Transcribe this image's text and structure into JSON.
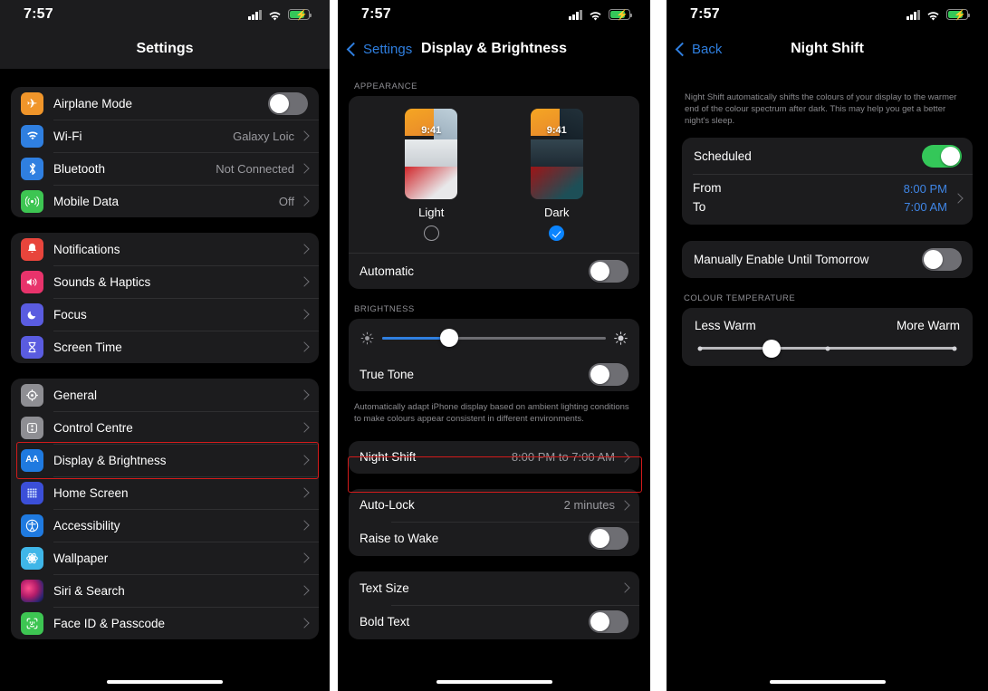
{
  "status_bar": {
    "time": "7:57",
    "signal": "cellular-signal-icon",
    "wifi": "wifi-icon",
    "battery": "battery-charging-icon"
  },
  "panel1": {
    "nav_title": "Settings",
    "groups": [
      {
        "rows": [
          {
            "icon": "airplane-icon",
            "color": "#f0952a",
            "label": "Airplane Mode",
            "control": "toggle",
            "on": false
          },
          {
            "icon": "wifi-icon",
            "color": "#2f7fe0",
            "label": "Wi-Fi",
            "value": "Galaxy Loic",
            "control": "chevron"
          },
          {
            "icon": "bluetooth-icon",
            "color": "#2f7fe0",
            "label": "Bluetooth",
            "value": "Not Connected",
            "control": "chevron"
          },
          {
            "icon": "mobile-data-icon",
            "color": "#3dc552",
            "label": "Mobile Data",
            "value": "Off",
            "control": "chevron"
          }
        ]
      },
      {
        "rows": [
          {
            "icon": "notifications-icon",
            "color": "#e8453c",
            "label": "Notifications",
            "value": "",
            "control": "chevron"
          },
          {
            "icon": "sounds-haptics-icon",
            "color": "#e8336b",
            "label": "Sounds & Haptics",
            "value": "",
            "control": "chevron"
          },
          {
            "icon": "focus-icon",
            "color": "#5a5ce0",
            "label": "Focus",
            "value": "",
            "control": "chevron"
          },
          {
            "icon": "screen-time-icon",
            "color": "#5a5ce0",
            "label": "Screen Time",
            "value": "",
            "control": "chevron"
          }
        ]
      },
      {
        "rows": [
          {
            "icon": "gear-icon",
            "color": "#8e8e93",
            "label": "General",
            "value": "",
            "control": "chevron"
          },
          {
            "icon": "control-centre-icon",
            "color": "#8e8e93",
            "label": "Control Centre",
            "value": "",
            "control": "chevron"
          },
          {
            "icon": "display-brightness-icon",
            "color": "#1f7ae0",
            "label": "Display & Brightness",
            "value": "",
            "control": "chevron",
            "highlighted": true
          },
          {
            "icon": "home-screen-icon",
            "color": "#3b4fd8",
            "label": "Home Screen",
            "value": "",
            "control": "chevron"
          },
          {
            "icon": "accessibility-icon",
            "color": "#1f7ae0",
            "label": "Accessibility",
            "value": "",
            "control": "chevron"
          },
          {
            "icon": "wallpaper-icon",
            "color": "#3fb6e8",
            "label": "Wallpaper",
            "value": "",
            "control": "chevron"
          },
          {
            "icon": "siri-search-icon",
            "color": "#2a2a38",
            "label": "Siri & Search",
            "value": "",
            "control": "chevron"
          },
          {
            "icon": "face-id-passcode-icon",
            "color": "#3dc552",
            "label": "Face ID & Passcode",
            "value": "",
            "control": "chevron"
          }
        ]
      }
    ]
  },
  "panel2": {
    "back_label": "Settings",
    "nav_title": "Display & Brightness",
    "appearance_header": "APPEARANCE",
    "appearance": {
      "light_label": "Light",
      "dark_label": "Dark",
      "thumb_time": "9:41",
      "selected": "Dark",
      "automatic_label": "Automatic",
      "automatic_on": false
    },
    "brightness_header": "BRIGHTNESS",
    "brightness": {
      "value_percent": 30,
      "low_icon": "brightness-low-icon",
      "high_icon": "brightness-high-icon"
    },
    "true_tone": {
      "label": "True Tone",
      "on": false
    },
    "true_tone_footnote": "Automatically adapt iPhone display based on ambient lighting conditions to make colours appear consistent in different environments.",
    "night_shift": {
      "label": "Night Shift",
      "value": "8:00 PM to 7:00 AM",
      "highlighted": true
    },
    "auto_lock": {
      "label": "Auto-Lock",
      "value": "2 minutes"
    },
    "raise_to_wake": {
      "label": "Raise to Wake",
      "on": false
    },
    "text_size": {
      "label": "Text Size"
    },
    "bold_text": {
      "label": "Bold Text",
      "on": false
    }
  },
  "panel3": {
    "back_label": "Back",
    "nav_title": "Night Shift",
    "description": "Night Shift automatically shifts the colours of your display to the warmer end of the colour spectrum after dark. This may help you get a better night's sleep.",
    "scheduled": {
      "label": "Scheduled",
      "on": true
    },
    "from": {
      "label": "From",
      "value": "8:00 PM"
    },
    "to": {
      "label": "To",
      "value": "7:00 AM"
    },
    "manual": {
      "label": "Manually Enable Until Tomorrow",
      "on": false
    },
    "colour_temperature_header": "COLOUR TEMPERATURE",
    "colour_temperature": {
      "less_label": "Less Warm",
      "more_label": "More Warm",
      "value_percent": 28
    }
  },
  "colors": {
    "accent_blue": "#2f7fe0",
    "toggle_green": "#34c759",
    "highlight_red": "#d21b1b"
  }
}
